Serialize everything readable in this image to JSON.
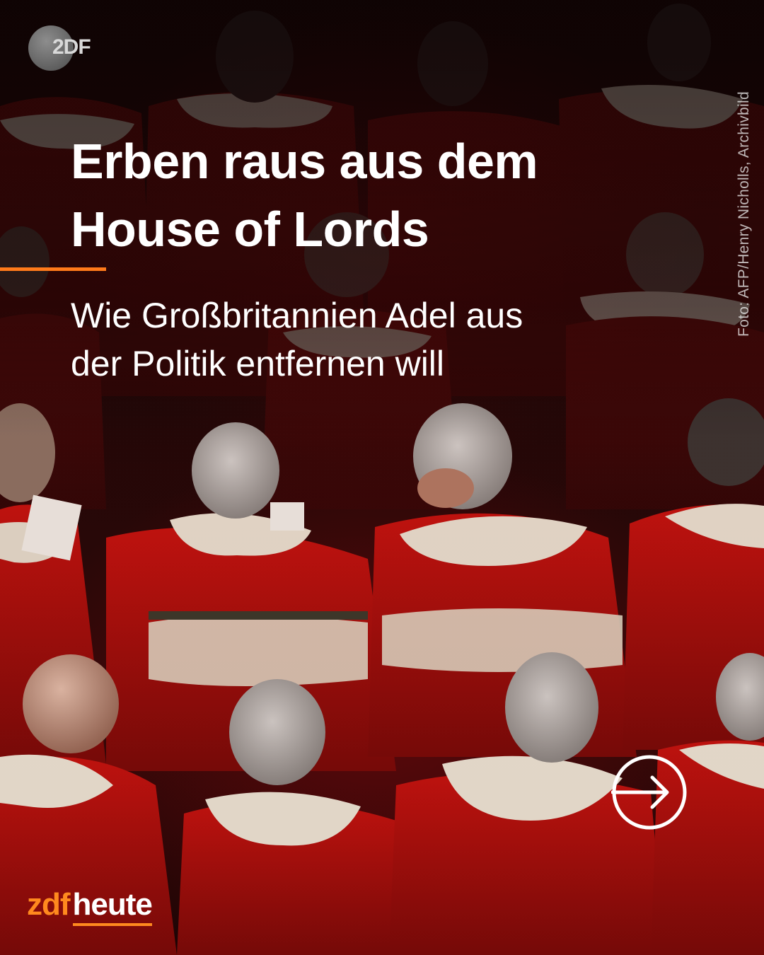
{
  "header": {
    "logo_text": "2DF"
  },
  "photo": {
    "credit": "Foto: AFP/Henry Nicholls, Archivbild",
    "subject": "peers-in-red-robes"
  },
  "content": {
    "headline_line1": "Erben raus aus dem",
    "headline_line2": "House of Lords",
    "subline_line1": "Wie Großbritannien Adel aus",
    "subline_line2": "der Politik entfernen will"
  },
  "navigation": {
    "next_icon": "arrow-right-circle-icon"
  },
  "brand": {
    "part1": "zdf",
    "part2": "heute"
  },
  "colors": {
    "accent": "#ff7a1a",
    "robe_red": "#b3100f",
    "text": "#ffffff"
  }
}
